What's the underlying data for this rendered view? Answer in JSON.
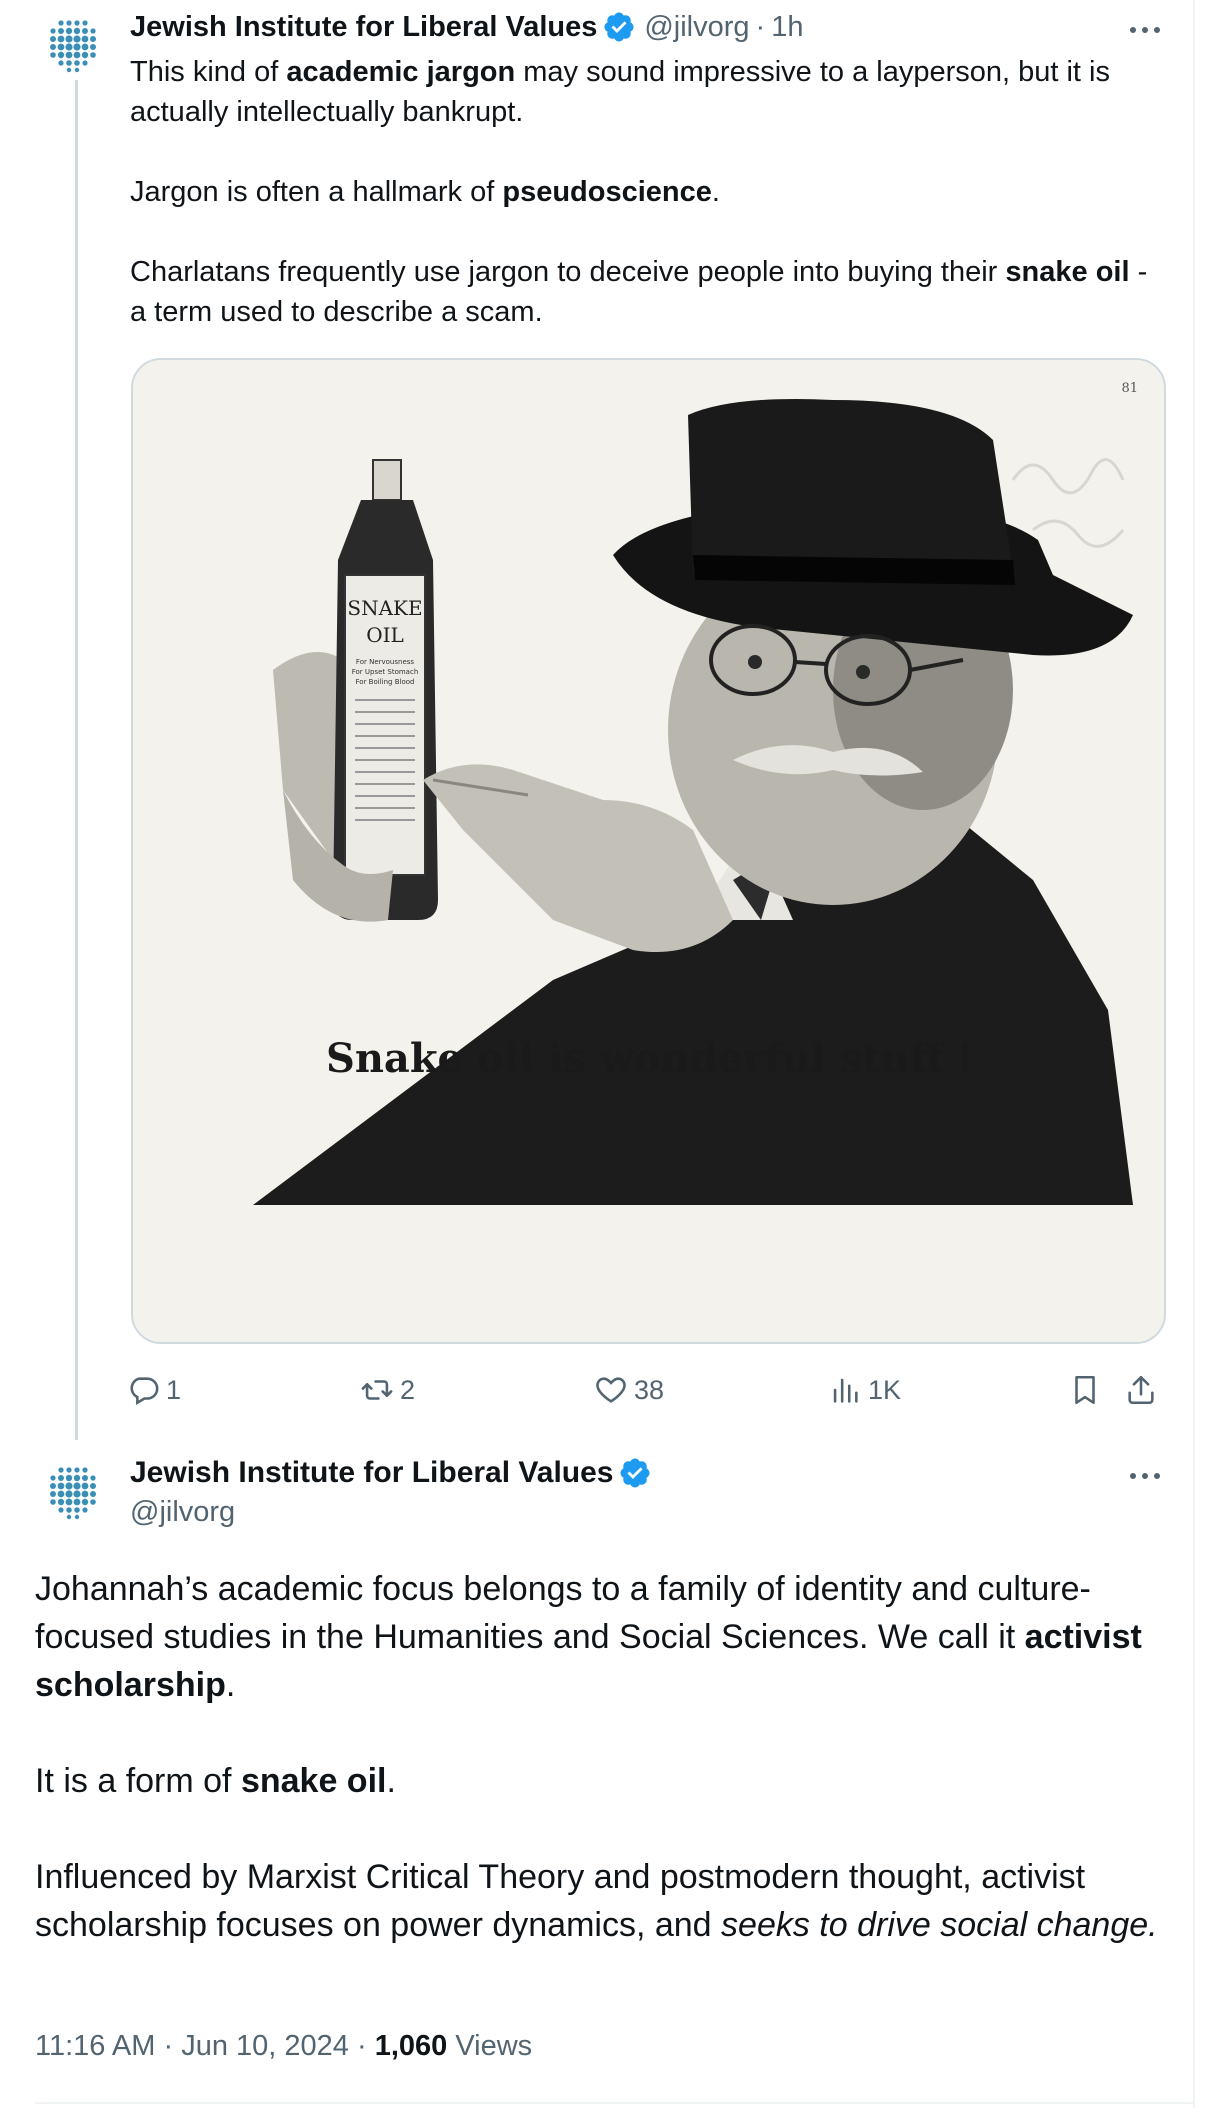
{
  "reply": {
    "author_name": "Jewish Institute for Liberal Values",
    "handle": "@jilvorg",
    "separator": "·",
    "time_ago": "1h",
    "body": {
      "p1_a": "This kind of ",
      "p1_b": "academic jargon",
      "p1_c": " may sound impressive to a layperson, but it is actually intellectually bankrupt.",
      "p2_a": "Jargon is often a hallmark of ",
      "p2_b": "pseudoscience",
      "p2_c": ".",
      "p3_a": "Charlatans frequently use jargon to deceive people into buying their ",
      "p3_b": "snake oil",
      "p3_c": " - a term used to describe a scam."
    },
    "media": {
      "caption": "Snake oil is wonderful stuff !",
      "page_number": "81",
      "bottle_label_line1": "SNAKE",
      "bottle_label_line2": "OIL",
      "bottle_uses": [
        "For Nervousness",
        "For Upset Stomach",
        "For Boiling Blood"
      ]
    },
    "actions": {
      "replies": "1",
      "reposts": "2",
      "likes": "38",
      "views": "1K"
    },
    "icons": [
      "reply-icon",
      "repost-icon",
      "like-icon",
      "views-icon",
      "bookmark-icon",
      "share-icon",
      "more-icon",
      "verified-badge-icon"
    ]
  },
  "main": {
    "author_name": "Jewish Institute for Liberal Values",
    "handle": "@jilvorg",
    "body": {
      "p1_a": "Johannah’s academic focus belongs to a family of identity and culture-focused studies in the Humanities and Social Sciences. We call it ",
      "p1_b": "activist scholarship",
      "p1_c": ".",
      "p2_a": "It is a form of ",
      "p2_b": "snake oil",
      "p2_c": ".",
      "p3_a": "Influenced by Marxist Critical Theory and postmodern thought, activist scholarship focuses on power dynamics, and ",
      "p3_b": "seeks to drive social change."
    },
    "footer": {
      "time": "11:16 AM",
      "sep1": "·",
      "date": "Jun 10, 2024",
      "sep2": "·",
      "views_count": "1,060",
      "views_label": "Views"
    }
  },
  "colors": {
    "text": "#0f1419",
    "secondary": "#536471",
    "verified": "#1d9bf0",
    "avatar": "#3a8fb7",
    "divider": "#cfd9de"
  }
}
